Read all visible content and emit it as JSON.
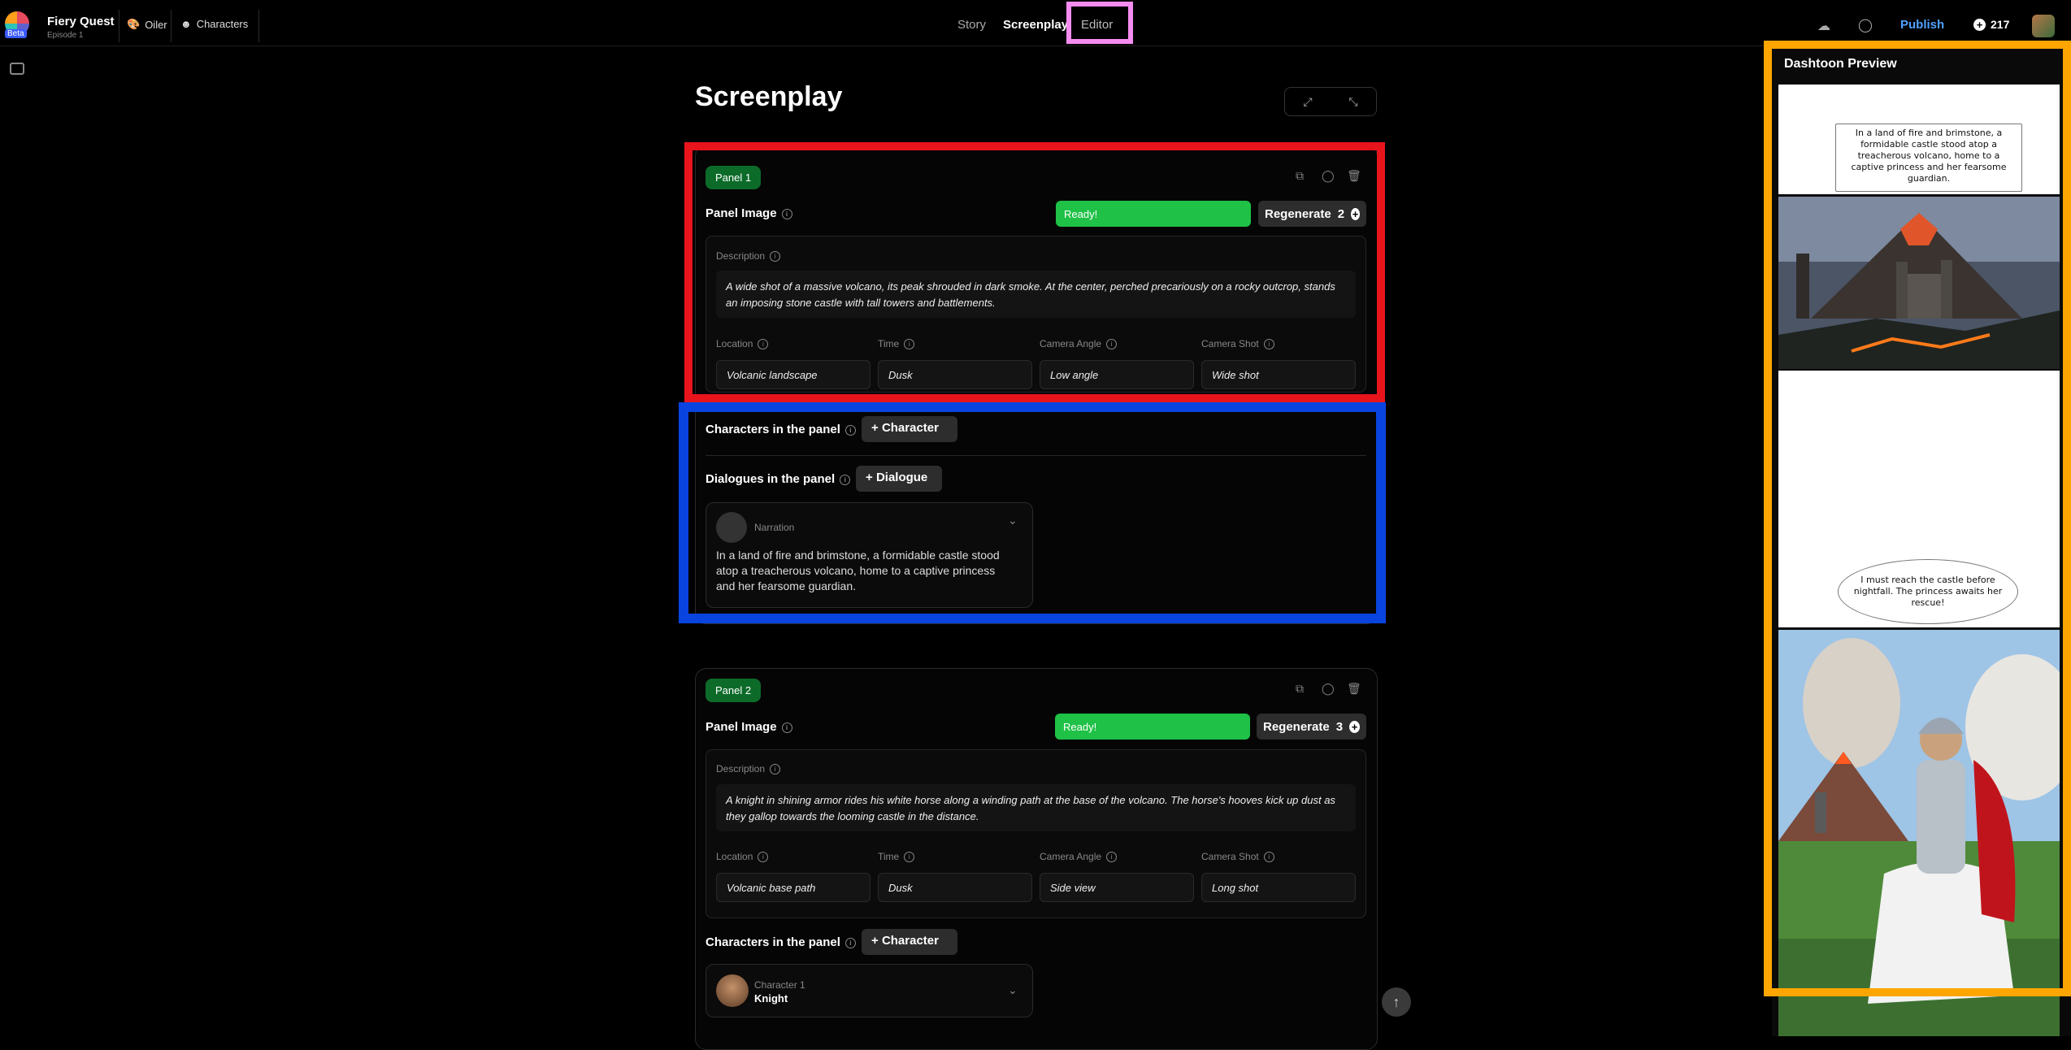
{
  "header": {
    "title": "Fiery Quest",
    "subtitle": "Episode 1",
    "logo_badge": "Beta",
    "workspace": "Oiler",
    "characters_link": "Characters",
    "modes": [
      "Story",
      "Screenplay",
      "Editor"
    ],
    "publish": "Publish",
    "credits": "217"
  },
  "page": {
    "title": "Screenplay"
  },
  "panels": [
    {
      "badge": "Panel 1",
      "image_label": "Panel Image",
      "status": "Ready!",
      "regenerate": "Regenerate",
      "regen_count": "2",
      "description_label": "Description",
      "description": "A wide shot of a massive volcano, its peak shrouded in dark smoke. At the center, perched precariously on a rocky outcrop, stands an imposing stone castle with tall towers and battlements.",
      "fields": [
        {
          "label": "Location",
          "value": "Volcanic landscape"
        },
        {
          "label": "Time",
          "value": "Dusk"
        },
        {
          "label": "Camera Angle",
          "value": "Low angle"
        },
        {
          "label": "Camera Shot",
          "value": "Wide shot"
        }
      ],
      "characters_label": "Characters in the panel",
      "add_character": "Character",
      "dialogues_label": "Dialogues in the panel",
      "add_dialogue": "Dialogue",
      "dialogue": {
        "speaker": "Narration",
        "text": "In a land of fire and brimstone, a formidable castle stood atop a treacherous volcano, home to a captive princess and her fearsome guardian."
      }
    },
    {
      "badge": "Panel 2",
      "image_label": "Panel Image",
      "status": "Ready!",
      "regenerate": "Regenerate",
      "regen_count": "3",
      "description_label": "Description",
      "description": "A knight in shining armor rides his white horse along a winding path at the base of the volcano. The horse's hooves kick up dust as they gallop towards the looming castle in the distance.",
      "fields": [
        {
          "label": "Location",
          "value": "Volcanic base path"
        },
        {
          "label": "Time",
          "value": "Dusk"
        },
        {
          "label": "Camera Angle",
          "value": "Side view"
        },
        {
          "label": "Camera Shot",
          "value": "Long shot"
        }
      ],
      "characters_label": "Characters in the panel",
      "add_character": "Character",
      "character": {
        "role": "Character 1",
        "name": "Knight"
      }
    }
  ],
  "preview": {
    "title": "Dashtoon Preview",
    "bubble1": "In a land of fire and brimstone, a formidable castle stood atop a treacherous volcano, home to a captive princess and her fearsome guardian.",
    "bubble2": "I must reach the castle before nightfall. The princess awaits her rescue!"
  },
  "colors": {
    "highlight_red": "#e8141c",
    "highlight_blue": "#0944e0",
    "highlight_orange": "#ffa500",
    "highlight_pink": "#f58cf0",
    "ready_green": "#1fc146",
    "badge_green": "#0d6b2a",
    "publish_blue": "#4ea1ff"
  }
}
